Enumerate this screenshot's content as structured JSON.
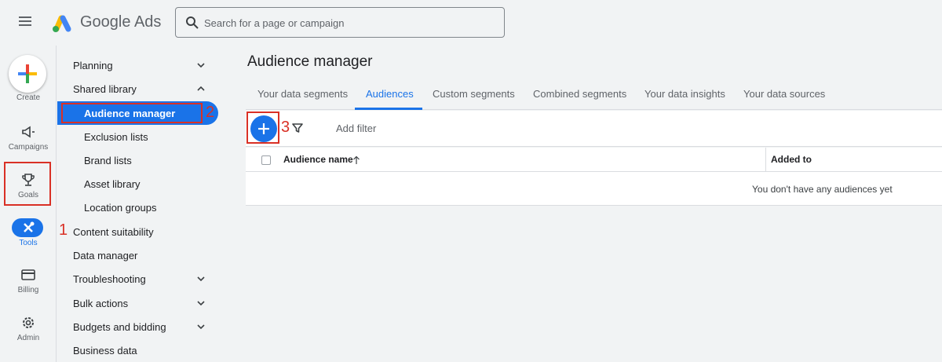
{
  "header": {
    "brand": "Google Ads",
    "search_placeholder": "Search for a page or campaign"
  },
  "rail": {
    "create": "Create",
    "items": [
      "Campaigns",
      "Goals",
      "Tools",
      "Billing",
      "Admin"
    ]
  },
  "annotations": {
    "a1": "1",
    "a2": "2",
    "a3": "3"
  },
  "nav": {
    "items": [
      "Planning",
      "Shared library",
      "Audience manager",
      "Exclusion lists",
      "Brand lists",
      "Asset library",
      "Location groups",
      "Content suitability",
      "Data manager",
      "Troubleshooting",
      "Bulk actions",
      "Budgets and bidding",
      "Business data"
    ]
  },
  "main": {
    "title": "Audience manager",
    "tabs": [
      "Your data segments",
      "Audiences",
      "Custom segments",
      "Combined segments",
      "Your data insights",
      "Your data sources"
    ],
    "add_filter": "Add filter",
    "col_audience_name": "Audience name",
    "col_added_to": "Added to",
    "empty_message": "You don't have any audiences yet"
  },
  "colors": {
    "accent": "#1a73e8",
    "annotation": "#d93025"
  }
}
